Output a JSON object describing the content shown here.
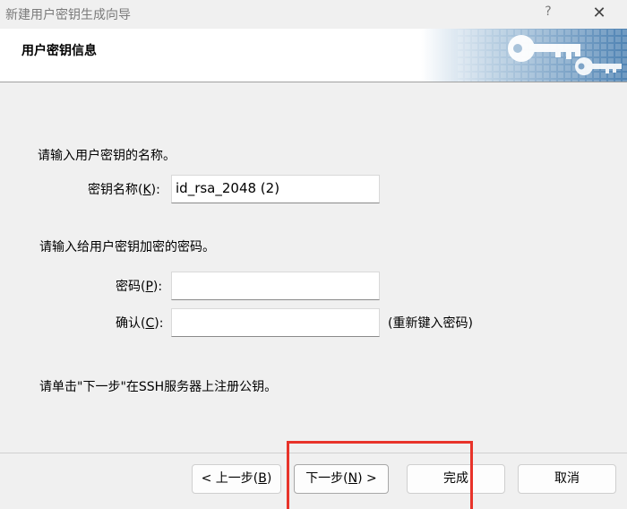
{
  "window": {
    "title": "新建用户密钥生成向导",
    "help": "?",
    "close": "✕"
  },
  "header": {
    "title": "用户密钥信息"
  },
  "section1": {
    "prompt": "请输入用户密钥的名称。",
    "key_name_label": "密钥名称(",
    "key_name_accel": "K",
    "key_name_suffix": "):",
    "key_name_value": "id_rsa_2048 (2)"
  },
  "section2": {
    "prompt": "请输入给用户密钥加密的密码。",
    "password_label": "密码(",
    "password_accel": "P",
    "password_suffix": "):",
    "password_value": "",
    "confirm_label": "确认(",
    "confirm_accel": "C",
    "confirm_suffix": "):",
    "confirm_value": "",
    "confirm_hint": "(重新键入密码)"
  },
  "note": "请单击\"下一步\"在SSH服务器上注册公钥。",
  "buttons": {
    "back": {
      "prefix": "< 上一步(",
      "accel": "B",
      "suffix": ")"
    },
    "next": {
      "prefix": "下一步(",
      "accel": "N",
      "suffix": ") >"
    },
    "finish": "完成",
    "cancel": "取消"
  },
  "colors": {
    "highlight": "#e8332a",
    "banner": "#5b8db8"
  }
}
